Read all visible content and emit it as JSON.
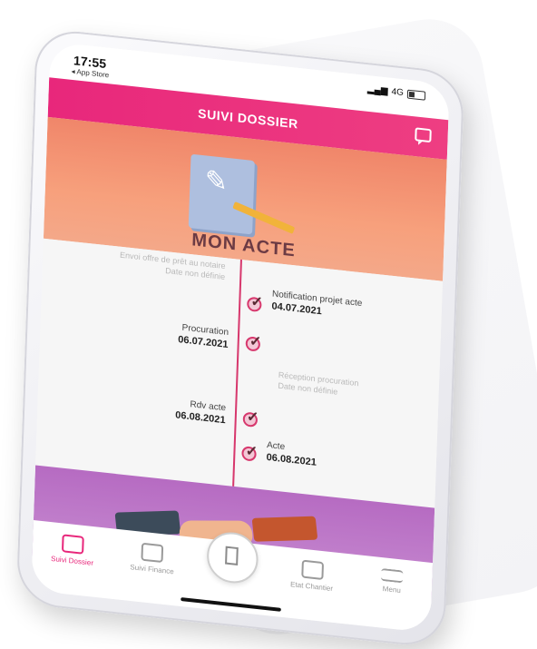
{
  "status": {
    "time": "17:55",
    "back_label": "◂ App Store",
    "network": "4G"
  },
  "header": {
    "title": "SUIVI DOSSIER",
    "icon": "chat-icon"
  },
  "hero": {
    "title": "MON ACTE"
  },
  "timeline": [
    {
      "label": "Envoi offre de prêt au notaire",
      "date": "Date non définie",
      "side": "left",
      "status": "pending"
    },
    {
      "label": "Notification projet acte",
      "date": "04.07.2021",
      "side": "right",
      "status": "done"
    },
    {
      "label": "Procuration",
      "date": "06.07.2021",
      "side": "left",
      "status": "done"
    },
    {
      "label": "Réception procuration",
      "date": "Date non définie",
      "side": "right",
      "status": "pending"
    },
    {
      "label": "Rdv acte",
      "date": "06.08.2021",
      "side": "left",
      "status": "done"
    },
    {
      "label": "Acte",
      "date": "06.08.2021",
      "side": "right",
      "status": "done"
    }
  ],
  "tabbar": {
    "items": [
      {
        "label": "Suivi Dossier",
        "icon": "folder-icon",
        "active": true
      },
      {
        "label": "Suivi Finance",
        "icon": "coins-icon",
        "active": false
      },
      {
        "label": "",
        "icon": "building-icon",
        "active": false
      },
      {
        "label": "Etat Chantier",
        "icon": "crane-icon",
        "active": false
      },
      {
        "label": "Menu",
        "icon": "menu-icon",
        "active": false
      }
    ]
  },
  "colors": {
    "accent": "#e8277b",
    "hero_bg": "#f3937a",
    "footer_bg": "#b66bc2",
    "timeline_line": "#d7386d"
  }
}
